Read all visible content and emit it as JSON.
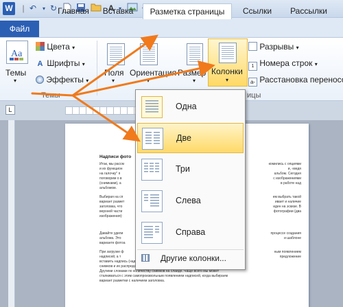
{
  "quick_access": {
    "logo_letter": "W",
    "icons": [
      "undo-icon",
      "redo-icon",
      "new-document-icon",
      "save-icon",
      "open-folder-icon",
      "font-color-icon",
      "insert-picture-icon",
      "customize-icon"
    ]
  },
  "tabs": {
    "file": "Файл",
    "home": "Главная",
    "insert": "Вставка",
    "page_layout": "Разметка страницы",
    "references": "Ссылки",
    "mailings": "Рассылки"
  },
  "ribbon": {
    "themes_group": {
      "themes_label": "Темы",
      "colors_label": "Цвета",
      "fonts_label": "Шрифты",
      "effects_label": "Эффекты",
      "group_label": "Темы"
    },
    "page_setup": {
      "margins_label": "Поля",
      "orientation_label": "Ориентация",
      "size_label": "Размер",
      "columns_label": "Колонки",
      "breaks_label": "Разрывы",
      "line_numbers_label": "Номера строк",
      "hyphenation_label": "Расстановка переносов",
      "group_label_fragment": "ицы"
    }
  },
  "columns_menu": {
    "items": [
      {
        "label": "Одна"
      },
      {
        "label": "Две"
      },
      {
        "label": "Три"
      },
      {
        "label": "Слева"
      },
      {
        "label": "Справа"
      }
    ],
    "more_label": "Другие колонки...",
    "selected_index": 1
  },
  "document": {
    "title_fragment": "Надписи фото",
    "paragraphs": [
      "Итак, мы рассм",
      "и их функцион",
      "на галочку\" п",
      "поговорим о в",
      "(снимками), а",
      "альбомом.",
      "Выбирая на сп",
      "вариант размет",
      "заголовка, что",
      "верхней части",
      "изображения):",
      "Давайте удели",
      "альбома. Это",
      "варианте фотоа",
      "При загрузке ф",
      "надписей, а т",
      "вставить надпись (надписи) связано с немалым количеством загруженных",
      "снимков и их распределения на слайдах, по одному на вариантов разметки.",
      "Другими словами по количеству снимков на слайде. Чаще всего мы может",
      "сталкиваться с этим самопроизвольным появлением надписей, когда выбираем",
      "вариант разметки с наличием заголовка."
    ],
    "right_fragments": [
      "комились с опциями",
      "и, «ведя",
      "альбом. Сегодня",
      "с изображениями",
      "в работе над",
      "ем выбрать такой",
      "ивает и наличие",
      "иден на эскизе. В",
      "фотографии (два",
      "процессе создания",
      "и шаблоне",
      "ным появлением",
      "предложение"
    ]
  },
  "annotation_color": "#f07a1c",
  "accent": "#2b5fb4"
}
